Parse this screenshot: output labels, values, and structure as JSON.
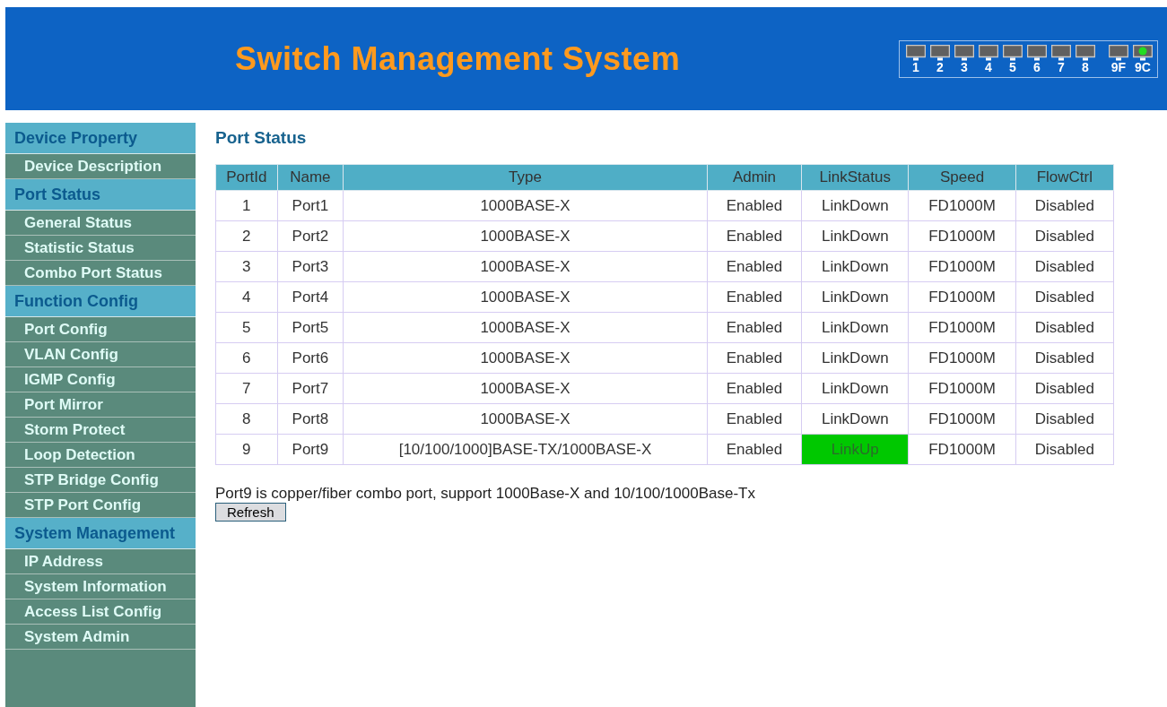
{
  "header": {
    "title": "Switch Management System",
    "ports": [
      {
        "label": "1",
        "linked": false
      },
      {
        "label": "2",
        "linked": false
      },
      {
        "label": "3",
        "linked": false
      },
      {
        "label": "4",
        "linked": false
      },
      {
        "label": "5",
        "linked": false
      },
      {
        "label": "6",
        "linked": false
      },
      {
        "label": "7",
        "linked": false
      },
      {
        "label": "8",
        "linked": false
      },
      {
        "label": "9F",
        "linked": false
      },
      {
        "label": "9C",
        "linked": true
      }
    ]
  },
  "sidebar": {
    "groups": [
      {
        "heading": "Device Property",
        "items": [
          "Device Description"
        ]
      },
      {
        "heading": "Port Status",
        "items": [
          "General Status",
          "Statistic Status",
          "Combo Port Status"
        ]
      },
      {
        "heading": "Function Config",
        "items": [
          "Port Config",
          "VLAN Config",
          "IGMP Config",
          "Port Mirror",
          "Storm Protect",
          "Loop Detection",
          "STP Bridge Config",
          "STP Port Config"
        ]
      },
      {
        "heading": "System Management",
        "items": [
          "IP Address",
          "System Information",
          "Access List Config",
          "System Admin"
        ]
      }
    ]
  },
  "page_title": "Port Status",
  "table": {
    "columns": [
      "PortId",
      "Name",
      "Type",
      "Admin",
      "LinkStatus",
      "Speed",
      "FlowCtrl"
    ],
    "rows": [
      {
        "cells": [
          "1",
          "Port1",
          "1000BASE-X",
          "Enabled",
          "LinkDown",
          "FD1000M",
          "Disabled"
        ],
        "link_up": false
      },
      {
        "cells": [
          "2",
          "Port2",
          "1000BASE-X",
          "Enabled",
          "LinkDown",
          "FD1000M",
          "Disabled"
        ],
        "link_up": false
      },
      {
        "cells": [
          "3",
          "Port3",
          "1000BASE-X",
          "Enabled",
          "LinkDown",
          "FD1000M",
          "Disabled"
        ],
        "link_up": false
      },
      {
        "cells": [
          "4",
          "Port4",
          "1000BASE-X",
          "Enabled",
          "LinkDown",
          "FD1000M",
          "Disabled"
        ],
        "link_up": false
      },
      {
        "cells": [
          "5",
          "Port5",
          "1000BASE-X",
          "Enabled",
          "LinkDown",
          "FD1000M",
          "Disabled"
        ],
        "link_up": false
      },
      {
        "cells": [
          "6",
          "Port6",
          "1000BASE-X",
          "Enabled",
          "LinkDown",
          "FD1000M",
          "Disabled"
        ],
        "link_up": false
      },
      {
        "cells": [
          "7",
          "Port7",
          "1000BASE-X",
          "Enabled",
          "LinkDown",
          "FD1000M",
          "Disabled"
        ],
        "link_up": false
      },
      {
        "cells": [
          "8",
          "Port8",
          "1000BASE-X",
          "Enabled",
          "LinkDown",
          "FD1000M",
          "Disabled"
        ],
        "link_up": false
      },
      {
        "cells": [
          "9",
          "Port9",
          "[10/100/1000]BASE-TX/1000BASE-X",
          "Enabled",
          "LinkUp",
          "FD1000M",
          "Disabled"
        ],
        "link_up": true
      }
    ]
  },
  "note": "Port9 is copper/fiber combo port, support 1000Base-X and 10/100/1000Base-Tx",
  "refresh_button": "Refresh"
}
